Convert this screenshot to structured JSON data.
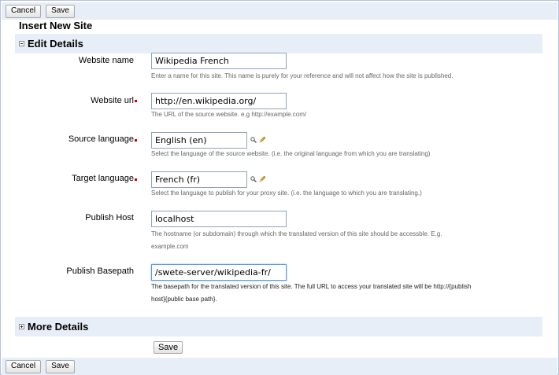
{
  "toolbar_top": {
    "cancel_label": "Cancel",
    "save_label": "Save"
  },
  "toolbar_bottom": {
    "cancel_label": "Cancel",
    "save_label": "Save"
  },
  "page_title": "Insert New Site",
  "sections": {
    "edit": {
      "title": "Edit Details",
      "toggle": "minus-icon"
    },
    "more": {
      "title": "More Details",
      "toggle": "plus-icon"
    }
  },
  "fields": {
    "website_name": {
      "label": "Website name",
      "value": "Wikipedia French",
      "help": "Enter a name for this site. This name is purely for your reference and will not affect how the site is published."
    },
    "website_url": {
      "label": "Website url",
      "value": "http://en.wikipedia.org/",
      "help": "The URL of the source website. e.g http://example.com/"
    },
    "source_language": {
      "label": "Source language",
      "value": "English (en)",
      "help": "Select the language of the source website. (i.e. the original language from which you are translating)"
    },
    "target_language": {
      "label": "Target language",
      "value": "French (fr)",
      "help": "Select the language to publish for your proxy site. (i.e. the language to which you are translating.)"
    },
    "publish_host": {
      "label": "Publish Host",
      "value": "localhost",
      "help_line1": "The hostname (or subdomain) through which the translated version of this site should be accessble. E.g.",
      "help_line2": "example.com"
    },
    "publish_basepath": {
      "label": "Publish Basepath",
      "value": "/swete-server/wikipedia-fr/",
      "help_line1": "The basepath for the translated version of this site. The full URL to access your translated site will be http://{publish",
      "help_line2": "host}{public base path}."
    }
  },
  "main_save_label": "Save",
  "icons": {
    "lookup": "magnifier-icon",
    "edit": "pencil-icon"
  },
  "colors": {
    "bar_bg": "#e8eef7",
    "required": "#cc0000",
    "border": "#b7c3d6"
  }
}
